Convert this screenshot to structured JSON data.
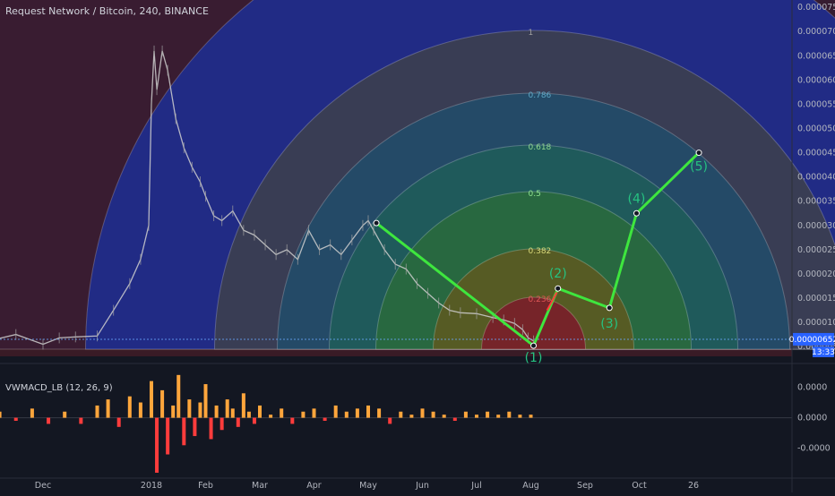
{
  "header": {
    "title": "Request Network / Bitcoin, 240, BINANCE"
  },
  "indicator": {
    "title": "VWMACD_LB (12, 26, 9)"
  },
  "colors": {
    "background": "#131722",
    "candle_up": "#a0a0a0",
    "candle_down": "#cfcfcf",
    "wave_line": "#3ee63e",
    "wave_label": "#26c281",
    "hist_pos": "#ffa63c",
    "hist_neg": "#ff3c3c",
    "fib_outer_blue": "#1f2d8f",
    "fib_red_zone": "#5a1f2a"
  },
  "chart_data": [
    {
      "type": "line",
      "title": "Request Network / Bitcoin, 240, BINANCE",
      "y_axis_side": "right",
      "y_ticks": [
        "0.00007500",
        "0.00007000",
        "0.00006500",
        "0.00006000",
        "0.00005500",
        "0.00005000",
        "0.00004500",
        "0.00004000",
        "0.00003500",
        "0.00003000",
        "0.00002500",
        "0.00002000",
        "0.00001500",
        "0.00001000",
        "0.00000500"
      ],
      "y_tick_values": [
        7.5e-05,
        7e-05,
        6.5e-05,
        6e-05,
        5.5e-05,
        5e-05,
        4.5e-05,
        4e-05,
        3.5e-05,
        3e-05,
        2.5e-05,
        2e-05,
        1.5e-05,
        1e-05,
        5e-06
      ],
      "ylim": [
        3e-06,
        7.65e-05
      ],
      "x_ticks": [
        "Dec",
        "2018",
        "Feb",
        "Mar",
        "Apr",
        "May",
        "Jun",
        "Jul",
        "Aug",
        "Sep",
        "Oct",
        "26"
      ],
      "x_tick_index": [
        1,
        3,
        4,
        5,
        6,
        7,
        8,
        9,
        10,
        11,
        12,
        13
      ],
      "price_series": {
        "name": "",
        "x": [
          0,
          0.5,
          1,
          1.3,
          1.6,
          2.0,
          2.3,
          2.6,
          2.8,
          2.95,
          3.0,
          3.05,
          3.1,
          3.2,
          3.3,
          3.45,
          3.6,
          3.75,
          3.9,
          4.0,
          4.15,
          4.3,
          4.5,
          4.7,
          4.9,
          5.1,
          5.3,
          5.5,
          5.7,
          5.9,
          6.1,
          6.3,
          6.5,
          6.7,
          6.9,
          7.0,
          7.1,
          7.3,
          7.5,
          7.7,
          7.9,
          8.1,
          8.3,
          8.5,
          8.7,
          9.0,
          9.3,
          9.5,
          9.7,
          9.85,
          9.95,
          10.05
        ],
        "y": [
          6.2e-06,
          7.5e-06,
          5.5e-06,
          6.8e-06,
          7e-06,
          7.2e-06,
          1.25e-05,
          1.8e-05,
          2.3e-05,
          3e-05,
          5.5e-05,
          6.6e-05,
          5.8e-05,
          6.6e-05,
          6.2e-05,
          5.2e-05,
          4.6e-05,
          4.2e-05,
          3.9e-05,
          3.6e-05,
          3.2e-05,
          3.1e-05,
          3.3e-05,
          2.9e-05,
          2.8e-05,
          2.6e-05,
          2.4e-05,
          2.5e-05,
          2.3e-05,
          2.9e-05,
          2.5e-05,
          2.6e-05,
          2.4e-05,
          2.7e-05,
          3e-05,
          3.1e-05,
          2.9e-05,
          2.5e-05,
          2.2e-05,
          2.1e-05,
          1.8e-05,
          1.6e-05,
          1.4e-05,
          1.25e-05,
          1.2e-05,
          1.18e-05,
          1.1e-05,
          1.05e-05,
          9.8e-06,
          8.5e-06,
          6.8e-06,
          6.2e-06
        ]
      },
      "wave_series": {
        "name": "",
        "labels": [
          "(1)",
          "(2)",
          "(3)",
          "(4)",
          "(5)"
        ],
        "x": [
          7.15,
          10.05,
          10.5,
          11.45,
          11.95,
          13.1
        ],
        "y": [
          3.05e-05,
          5.2e-06,
          1.7e-05,
          1.3e-05,
          3.25e-05,
          4.5e-05
        ]
      },
      "fib_arc_levels": [
        "1",
        "0.786",
        "0.618",
        "0.5",
        "0.382",
        "0.236"
      ],
      "current_price_tag": "0.00000652",
      "countdown_tag": "13:33"
    },
    {
      "type": "bar",
      "title": "VWMACD_LB (12, 26, 9)",
      "y_ticks": [
        "0.0000",
        "0.0000",
        "-0.0000"
      ],
      "y_tick_values": [
        1e-06,
        0.0,
        -1e-06
      ],
      "ylim": [
        -1.8e-06,
        1.6e-06
      ],
      "histogram": {
        "name": "",
        "x": [
          0.2,
          0.5,
          0.8,
          1.1,
          1.4,
          1.7,
          2.0,
          2.2,
          2.4,
          2.6,
          2.8,
          3.0,
          3.1,
          3.2,
          3.3,
          3.4,
          3.5,
          3.6,
          3.7,
          3.8,
          3.9,
          4.0,
          4.1,
          4.2,
          4.3,
          4.4,
          4.5,
          4.6,
          4.7,
          4.8,
          4.9,
          5.0,
          5.2,
          5.4,
          5.6,
          5.8,
          6.0,
          6.2,
          6.4,
          6.6,
          6.8,
          7.0,
          7.2,
          7.4,
          7.6,
          7.8,
          8.0,
          8.2,
          8.4,
          8.6,
          8.8,
          9.0,
          9.2,
          9.4,
          9.6,
          9.8,
          10.0
        ],
        "values": [
          2e-07,
          -1e-07,
          3e-07,
          -2e-07,
          2e-07,
          -2e-07,
          4e-07,
          6e-07,
          -3e-07,
          7e-07,
          5e-07,
          1.2e-06,
          -1.8e-06,
          9e-07,
          -1.2e-06,
          4e-07,
          1.4e-06,
          -9e-07,
          6e-07,
          -6e-07,
          5e-07,
          1.1e-06,
          -7e-07,
          4e-07,
          -4e-07,
          6e-07,
          3e-07,
          -3e-07,
          8e-07,
          2e-07,
          -2e-07,
          4e-07,
          1e-07,
          3e-07,
          -2e-07,
          2e-07,
          3e-07,
          -1e-07,
          4e-07,
          2e-07,
          3e-07,
          4e-07,
          3e-07,
          -2e-07,
          2e-07,
          1e-07,
          3e-07,
          2e-07,
          1e-07,
          -1e-07,
          2e-07,
          1e-07,
          2e-07,
          1e-07,
          2e-07,
          1e-07,
          1e-07
        ]
      }
    }
  ]
}
